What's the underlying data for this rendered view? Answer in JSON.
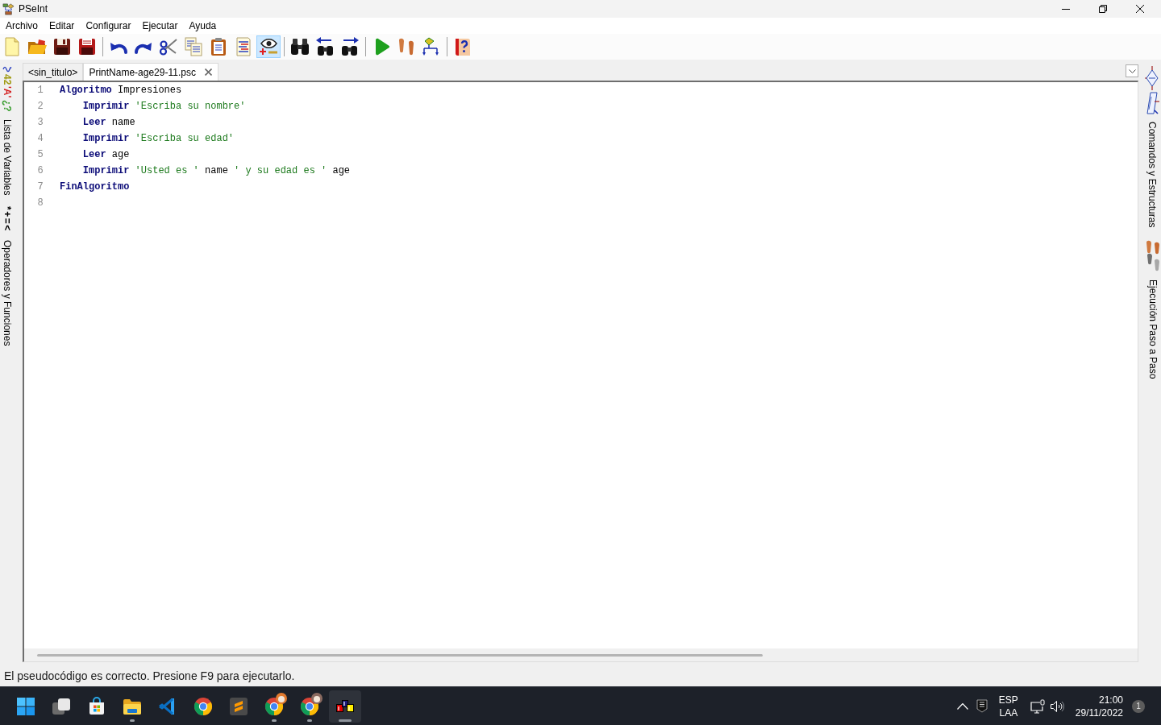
{
  "window": {
    "title": "PSeInt"
  },
  "menu": [
    "Archivo",
    "Editar",
    "Configurar",
    "Ejecutar",
    "Ayuda"
  ],
  "toolbar": {
    "groups": [
      [
        {
          "kind": "new",
          "on": false
        },
        {
          "kind": "open",
          "on": false
        },
        {
          "kind": "save",
          "on": false
        },
        {
          "kind": "save_as",
          "on": false
        }
      ],
      [
        {
          "kind": "undo",
          "on": false
        },
        {
          "kind": "redo",
          "on": false
        },
        {
          "kind": "cut",
          "on": false
        },
        {
          "kind": "copy",
          "on": false
        },
        {
          "kind": "paste",
          "on": false
        },
        {
          "kind": "format",
          "on": false
        },
        {
          "kind": "watch",
          "on": true
        }
      ],
      [
        {
          "kind": "find",
          "on": false
        },
        {
          "kind": "find_previous",
          "on": false
        },
        {
          "kind": "find_next",
          "on": false
        }
      ],
      [
        {
          "kind": "run",
          "on": false
        },
        {
          "kind": "step",
          "on": false
        },
        {
          "kind": "flowchart",
          "on": false
        }
      ],
      [
        {
          "kind": "help",
          "on": false
        }
      ]
    ]
  },
  "left_panel": {
    "tabs": [
      {
        "kind": "variables",
        "symbols": [
          {
            "text": "42",
            "color": "#a09a10"
          },
          {
            "text": "'A'",
            "color": "#d42020"
          },
          {
            "text": "¿?",
            "color": "#3a9e30"
          }
        ],
        "label": "Lista de Variables"
      },
      {
        "kind": "operators",
        "symbols": [
          {
            "text": "*+=<",
            "color": "#000000"
          }
        ],
        "label": "Operadores y Funciones"
      }
    ]
  },
  "editor": {
    "tabs": [
      {
        "label": "<sin_titulo>",
        "selected": false
      },
      {
        "label": "PrintName-age29-11.psc",
        "selected": true
      }
    ],
    "lines": [
      {
        "number": "1",
        "tokens": [
          {
            "kind": "keyword",
            "text": "Algoritmo"
          },
          {
            "kind": "plain",
            "text": " Impresiones"
          }
        ],
        "children": [
          {
            "number": "2",
            "tokens": [
              {
                "kind": "keyword",
                "text": "Imprimir"
              },
              {
                "kind": "string",
                "text": " 'Escriba su nombre'"
              }
            ]
          },
          {
            "number": "3",
            "tokens": [
              {
                "kind": "keyword",
                "text": "Leer"
              },
              {
                "kind": "plain",
                "text": " name"
              }
            ]
          },
          {
            "number": "4",
            "tokens": [
              {
                "kind": "keyword",
                "text": "Imprimir"
              },
              {
                "kind": "string",
                "text": " 'Escriba su edad'"
              }
            ]
          },
          {
            "number": "5",
            "tokens": [
              {
                "kind": "keyword",
                "text": "Leer"
              },
              {
                "kind": "plain",
                "text": " age"
              }
            ]
          },
          {
            "number": "6",
            "tokens": [
              {
                "kind": "keyword",
                "text": "Imprimir"
              },
              {
                "kind": "string",
                "text": " 'Usted es '"
              },
              {
                "kind": "plain",
                "text": " name"
              },
              {
                "kind": "string",
                "text": " ' y su edad es '"
              },
              {
                "kind": "plain",
                "text": " age"
              }
            ]
          }
        ]
      },
      {
        "number": "7",
        "tokens": [
          {
            "kind": "keyword",
            "text": "FinAlgoritmo"
          }
        ]
      },
      {
        "number": "8"
      }
    ]
  },
  "right_panel": {
    "tabs": [
      {
        "kind": "commands",
        "label": "Comandos y Estructuras"
      },
      {
        "kind": "steps",
        "label": "Ejecución Paso a Paso"
      }
    ]
  },
  "status_bar": "El pseudocódigo es correcto. Presione F9 para ejecutarlo.",
  "taskbar": {
    "apps": [
      {
        "kind": "start",
        "running": false,
        "active": false
      },
      {
        "kind": "taskview",
        "running": false,
        "active": false
      },
      {
        "kind": "store",
        "running": false,
        "active": false
      },
      {
        "kind": "files",
        "running": true,
        "active": false
      },
      {
        "kind": "coder",
        "running": false,
        "active": false
      },
      {
        "kind": "browser",
        "running": false,
        "active": false
      },
      {
        "kind": "notes",
        "running": false,
        "active": false
      },
      {
        "kind": "fox",
        "running": true,
        "active": false
      },
      {
        "kind": "ape",
        "running": true,
        "active": false
      },
      {
        "kind": "pseint",
        "running": true,
        "active": true
      }
    ],
    "tray": {
      "language": [
        "ESP",
        "LAA"
      ],
      "time": "21:00",
      "date": "29/11/2022",
      "notifications": "1"
    }
  }
}
